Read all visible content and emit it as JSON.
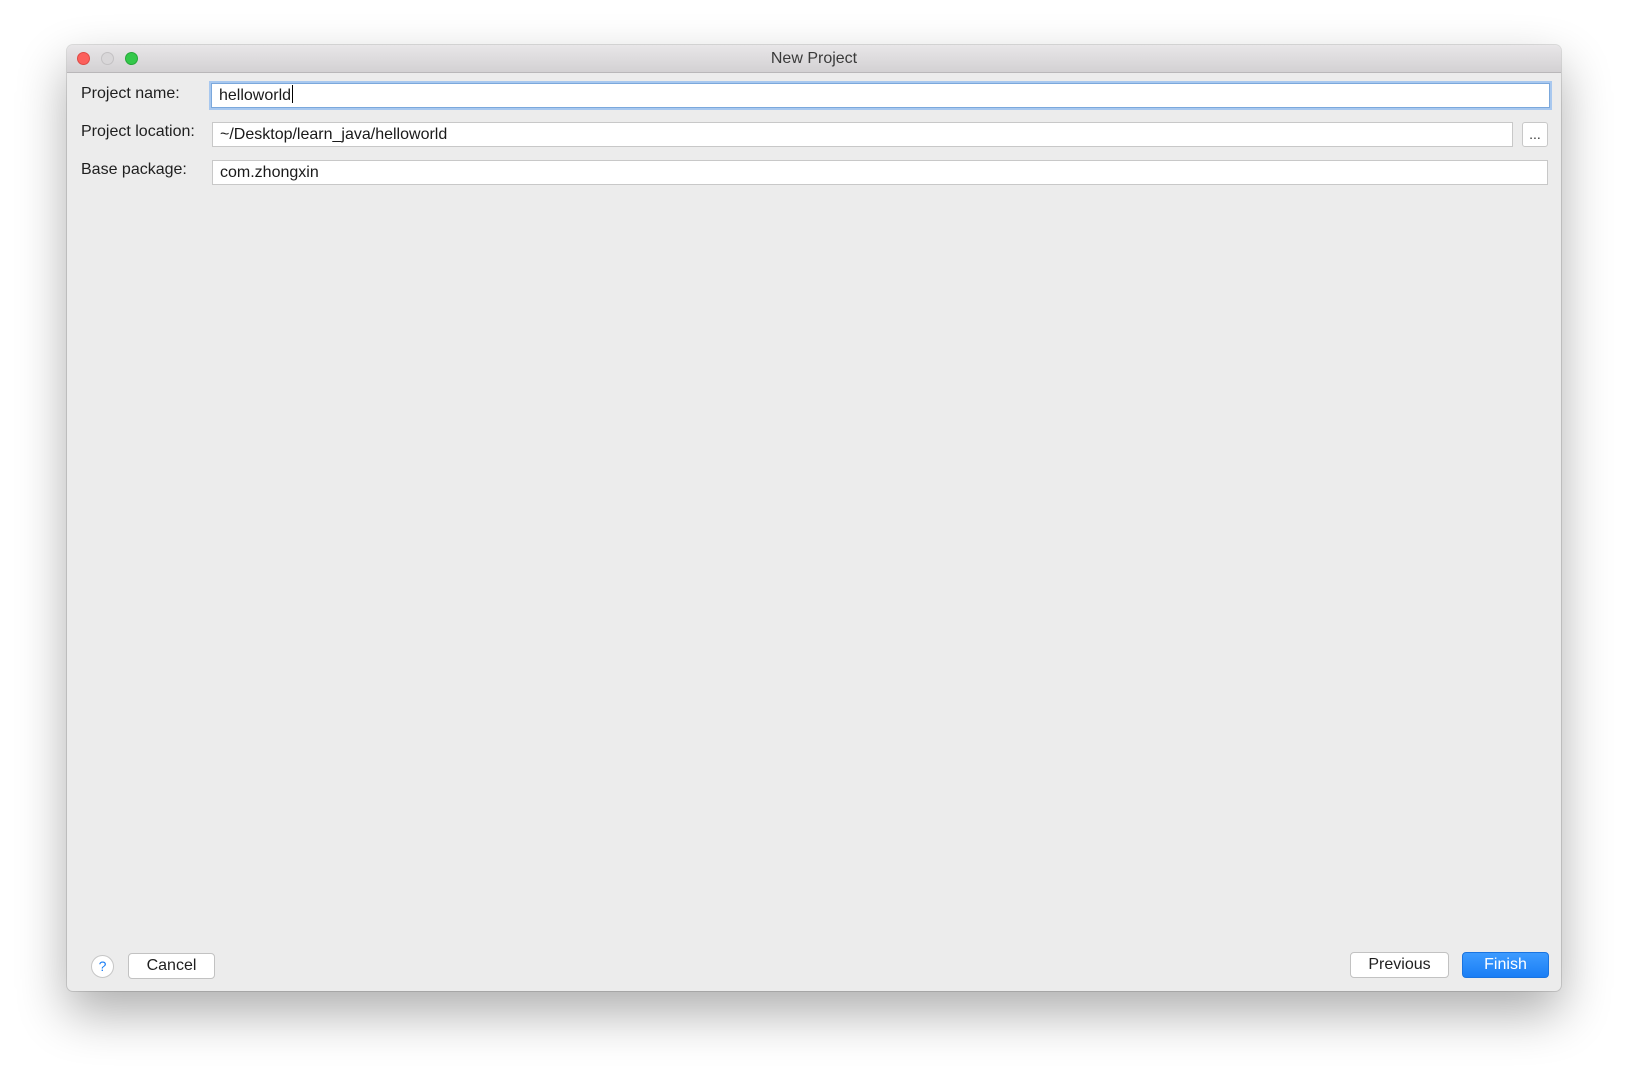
{
  "window": {
    "title": "New Project"
  },
  "form": {
    "project_name": {
      "label": "Project name:",
      "value": "helloworld"
    },
    "project_location": {
      "label": "Project location:",
      "value": "~/Desktop/learn_java/helloworld",
      "browse_label": "..."
    },
    "base_package": {
      "label": "Base package:",
      "value": "com.zhongxin"
    }
  },
  "footer": {
    "help_label": "?",
    "cancel_label": "Cancel",
    "previous_label": "Previous",
    "finish_label": "Finish"
  },
  "colors": {
    "accent": "#1a7ef5",
    "window_background": "#ececec",
    "focus_ring": "#a8c8ef",
    "close_button": "#fc605c",
    "zoom_button": "#34c84a"
  },
  "icons": {
    "close": "close-icon",
    "minimize": "minimize-icon",
    "zoom": "zoom-icon",
    "help": "help-icon",
    "browse": "ellipsis-icon"
  }
}
